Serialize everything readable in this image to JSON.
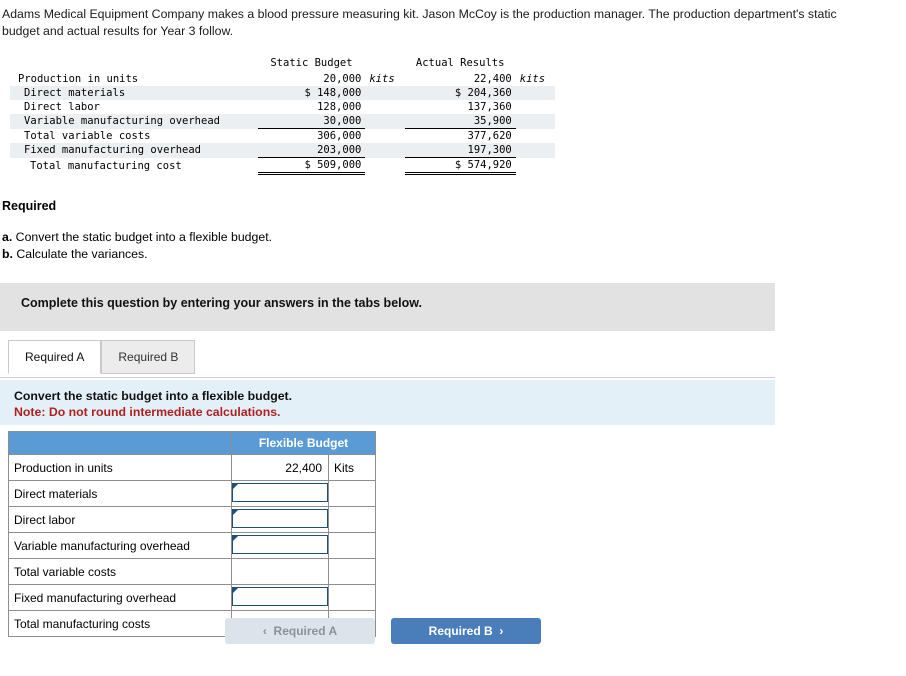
{
  "intro": {
    "text": "Adams Medical Equipment Company makes a blood pressure measuring kit. Jason McCoy is the production manager. The production department's static budget and actual results for Year 3 follow."
  },
  "budget_table": {
    "headers": {
      "blank": "",
      "static": "Static Budget",
      "actual": "Actual Results"
    },
    "rows": [
      {
        "label": "Production in units",
        "static": "20,000",
        "static_unit": "kits",
        "actual": "22,400",
        "actual_unit": "kits",
        "shaded": false,
        "rule": "none"
      },
      {
        "label": "Direct materials",
        "static": "$ 148,000",
        "static_unit": "",
        "actual": "$ 204,360",
        "actual_unit": "",
        "shaded": true,
        "rule": "none"
      },
      {
        "label": "Direct labor",
        "static": "128,000",
        "static_unit": "",
        "actual": "137,360",
        "actual_unit": "",
        "shaded": false,
        "rule": "none"
      },
      {
        "label": "Variable manufacturing overhead",
        "static": "30,000",
        "static_unit": "",
        "actual": "35,900",
        "actual_unit": "",
        "shaded": true,
        "rule": "none"
      },
      {
        "label": "Total variable costs",
        "static": "306,000",
        "static_unit": "",
        "actual": "377,620",
        "actual_unit": "",
        "shaded": false,
        "rule": "top"
      },
      {
        "label": "Fixed manufacturing overhead",
        "static": "203,000",
        "static_unit": "",
        "actual": "197,300",
        "actual_unit": "",
        "shaded": true,
        "rule": "none"
      },
      {
        "label": "Total manufacturing cost",
        "static": "$ 509,000",
        "static_unit": "",
        "actual": "$ 574,920",
        "actual_unit": "",
        "shaded": false,
        "rule": "double"
      }
    ]
  },
  "required": {
    "title": "Required",
    "item_a_marker": "a.",
    "item_a": " Convert the static budget into a flexible budget.",
    "item_b_marker": "b.",
    "item_b": " Calculate the variances."
  },
  "banner": {
    "text": "Complete this question by entering your answers in the tabs below."
  },
  "tabs": [
    {
      "label": "Required A",
      "active": true
    },
    {
      "label": "Required B",
      "active": false
    }
  ],
  "instruction": {
    "line1": "Convert the static budget into a flexible budget.",
    "line2": "Note: Do not round intermediate calculations."
  },
  "answer_table": {
    "header": {
      "blank": "",
      "flexible_budget": "Flexible Budget"
    },
    "rows": [
      {
        "label": "Production in units",
        "value": "22,400",
        "unit": "Kits",
        "input": false
      },
      {
        "label": "Direct materials",
        "value": "",
        "unit": "",
        "input": true
      },
      {
        "label": "Direct labor",
        "value": "",
        "unit": "",
        "input": true
      },
      {
        "label": "Variable manufacturing overhead",
        "value": "",
        "unit": "",
        "input": true
      },
      {
        "label": "Total variable costs",
        "value": "",
        "unit": "",
        "input": false
      },
      {
        "label": "Fixed manufacturing overhead",
        "value": "",
        "unit": "",
        "input": true
      },
      {
        "label": "Total manufacturing costs",
        "value": "",
        "unit": "",
        "input": false
      }
    ]
  },
  "nav": {
    "prev_label": "Required A",
    "prev_icon": "chevron-left-icon",
    "next_label": "Required B",
    "next_icon": "chevron-right-icon"
  },
  "colors": {
    "accent_blue": "#4a7ebb",
    "table_header_blue": "#5b9bd5",
    "instruction_bg": "#e3f0f8",
    "banner_bg": "#e2e2e2",
    "note_red": "#b02020",
    "input_border": "#1f4e79"
  }
}
